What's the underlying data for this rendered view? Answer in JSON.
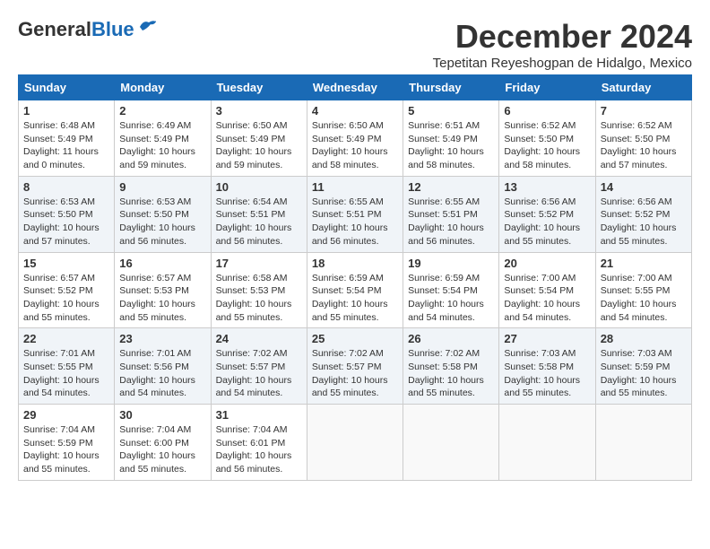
{
  "header": {
    "logo_general": "General",
    "logo_blue": "Blue",
    "month_title": "December 2024",
    "location": "Tepetitan Reyeshogpan de Hidalgo, Mexico"
  },
  "columns": [
    "Sunday",
    "Monday",
    "Tuesday",
    "Wednesday",
    "Thursday",
    "Friday",
    "Saturday"
  ],
  "weeks": [
    [
      {
        "day": "1",
        "sunrise": "6:48 AM",
        "sunset": "5:49 PM",
        "daylight": "11 hours and 0 minutes."
      },
      {
        "day": "2",
        "sunrise": "6:49 AM",
        "sunset": "5:49 PM",
        "daylight": "10 hours and 59 minutes."
      },
      {
        "day": "3",
        "sunrise": "6:50 AM",
        "sunset": "5:49 PM",
        "daylight": "10 hours and 59 minutes."
      },
      {
        "day": "4",
        "sunrise": "6:50 AM",
        "sunset": "5:49 PM",
        "daylight": "10 hours and 58 minutes."
      },
      {
        "day": "5",
        "sunrise": "6:51 AM",
        "sunset": "5:49 PM",
        "daylight": "10 hours and 58 minutes."
      },
      {
        "day": "6",
        "sunrise": "6:52 AM",
        "sunset": "5:50 PM",
        "daylight": "10 hours and 58 minutes."
      },
      {
        "day": "7",
        "sunrise": "6:52 AM",
        "sunset": "5:50 PM",
        "daylight": "10 hours and 57 minutes."
      }
    ],
    [
      {
        "day": "8",
        "sunrise": "6:53 AM",
        "sunset": "5:50 PM",
        "daylight": "10 hours and 57 minutes."
      },
      {
        "day": "9",
        "sunrise": "6:53 AM",
        "sunset": "5:50 PM",
        "daylight": "10 hours and 56 minutes."
      },
      {
        "day": "10",
        "sunrise": "6:54 AM",
        "sunset": "5:51 PM",
        "daylight": "10 hours and 56 minutes."
      },
      {
        "day": "11",
        "sunrise": "6:55 AM",
        "sunset": "5:51 PM",
        "daylight": "10 hours and 56 minutes."
      },
      {
        "day": "12",
        "sunrise": "6:55 AM",
        "sunset": "5:51 PM",
        "daylight": "10 hours and 56 minutes."
      },
      {
        "day": "13",
        "sunrise": "6:56 AM",
        "sunset": "5:52 PM",
        "daylight": "10 hours and 55 minutes."
      },
      {
        "day": "14",
        "sunrise": "6:56 AM",
        "sunset": "5:52 PM",
        "daylight": "10 hours and 55 minutes."
      }
    ],
    [
      {
        "day": "15",
        "sunrise": "6:57 AM",
        "sunset": "5:52 PM",
        "daylight": "10 hours and 55 minutes."
      },
      {
        "day": "16",
        "sunrise": "6:57 AM",
        "sunset": "5:53 PM",
        "daylight": "10 hours and 55 minutes."
      },
      {
        "day": "17",
        "sunrise": "6:58 AM",
        "sunset": "5:53 PM",
        "daylight": "10 hours and 55 minutes."
      },
      {
        "day": "18",
        "sunrise": "6:59 AM",
        "sunset": "5:54 PM",
        "daylight": "10 hours and 55 minutes."
      },
      {
        "day": "19",
        "sunrise": "6:59 AM",
        "sunset": "5:54 PM",
        "daylight": "10 hours and 54 minutes."
      },
      {
        "day": "20",
        "sunrise": "7:00 AM",
        "sunset": "5:54 PM",
        "daylight": "10 hours and 54 minutes."
      },
      {
        "day": "21",
        "sunrise": "7:00 AM",
        "sunset": "5:55 PM",
        "daylight": "10 hours and 54 minutes."
      }
    ],
    [
      {
        "day": "22",
        "sunrise": "7:01 AM",
        "sunset": "5:55 PM",
        "daylight": "10 hours and 54 minutes."
      },
      {
        "day": "23",
        "sunrise": "7:01 AM",
        "sunset": "5:56 PM",
        "daylight": "10 hours and 54 minutes."
      },
      {
        "day": "24",
        "sunrise": "7:02 AM",
        "sunset": "5:57 PM",
        "daylight": "10 hours and 54 minutes."
      },
      {
        "day": "25",
        "sunrise": "7:02 AM",
        "sunset": "5:57 PM",
        "daylight": "10 hours and 55 minutes."
      },
      {
        "day": "26",
        "sunrise": "7:02 AM",
        "sunset": "5:58 PM",
        "daylight": "10 hours and 55 minutes."
      },
      {
        "day": "27",
        "sunrise": "7:03 AM",
        "sunset": "5:58 PM",
        "daylight": "10 hours and 55 minutes."
      },
      {
        "day": "28",
        "sunrise": "7:03 AM",
        "sunset": "5:59 PM",
        "daylight": "10 hours and 55 minutes."
      }
    ],
    [
      {
        "day": "29",
        "sunrise": "7:04 AM",
        "sunset": "5:59 PM",
        "daylight": "10 hours and 55 minutes."
      },
      {
        "day": "30",
        "sunrise": "7:04 AM",
        "sunset": "6:00 PM",
        "daylight": "10 hours and 55 minutes."
      },
      {
        "day": "31",
        "sunrise": "7:04 AM",
        "sunset": "6:01 PM",
        "daylight": "10 hours and 56 minutes."
      },
      null,
      null,
      null,
      null
    ]
  ]
}
